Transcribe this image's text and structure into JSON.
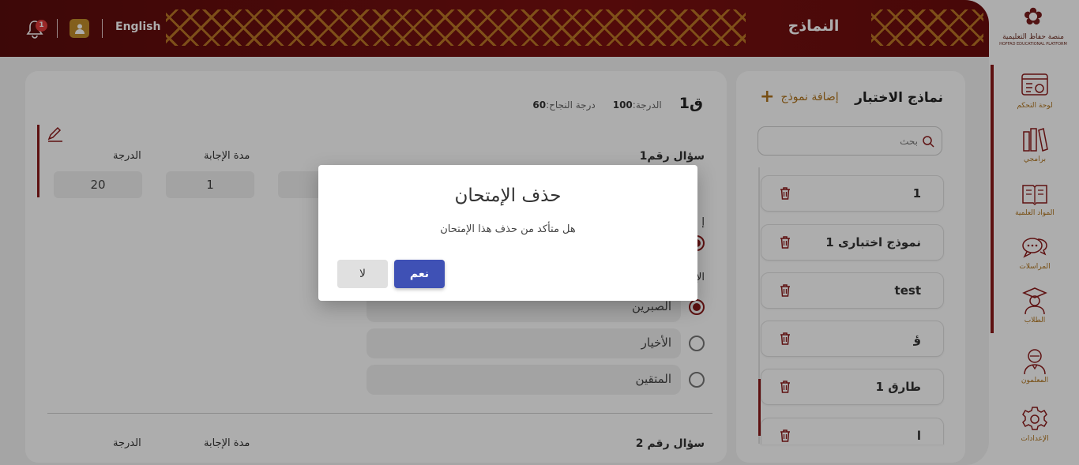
{
  "header": {
    "title": "النماذج",
    "language": "English",
    "notifications_count": "1"
  },
  "sidebar": {
    "logo_line1": "منصة حفاظ التعليمية",
    "logo_line2": "HOFFAD EDUCATIONAL PLATFORM",
    "items": [
      {
        "label": "لوحة التحكم",
        "icon": "dashboard-icon"
      },
      {
        "label": "برامجي",
        "icon": "books-icon"
      },
      {
        "label": "المواد العلمية",
        "icon": "book-open-icon"
      },
      {
        "label": "المراسلات",
        "icon": "chat-icon"
      },
      {
        "label": "الطلاب",
        "icon": "graduate-icon"
      },
      {
        "label": "المعلمون",
        "icon": "teacher-icon"
      },
      {
        "label": "الإعدادات",
        "icon": "settings-icon"
      }
    ]
  },
  "models_panel": {
    "title": "نماذج الاختبار",
    "add_label": "إضافة نموذج",
    "search_placeholder": "بحث",
    "items": [
      "1",
      "نموذج اختبارى 1",
      "test",
      "ؤ",
      "طارق 1",
      "ا"
    ]
  },
  "question_panel": {
    "name": "ق1",
    "grade_label": "الدرجة:",
    "grade_value": "100",
    "pass_label": "درجة النجاح:",
    "pass_value": "60",
    "q1": {
      "title": "سؤال رقم1",
      "duration_label": "مدة الإجابة",
      "grade_label": "الدرجة",
      "duration_value": "1",
      "grade_value": "20",
      "partial_label_1": "إ",
      "partial_label_2": "الإ",
      "options": [
        "الصبرين",
        "الأخيار",
        "المتقين"
      ]
    },
    "q2": {
      "title": "سؤال رقم 2",
      "duration_label": "مدة الإجابة",
      "grade_label": "الدرجة"
    }
  },
  "dialog": {
    "title": "حذف الإمتحان",
    "message": "هل متأكد من حذف هذا الإمتحان",
    "yes_label": "نعم",
    "no_label": "لا"
  },
  "colors": {
    "header": "#6a0d0d",
    "accent": "#8b1a1a",
    "gold": "#b0741c",
    "primary_button": "#3f51b5"
  }
}
